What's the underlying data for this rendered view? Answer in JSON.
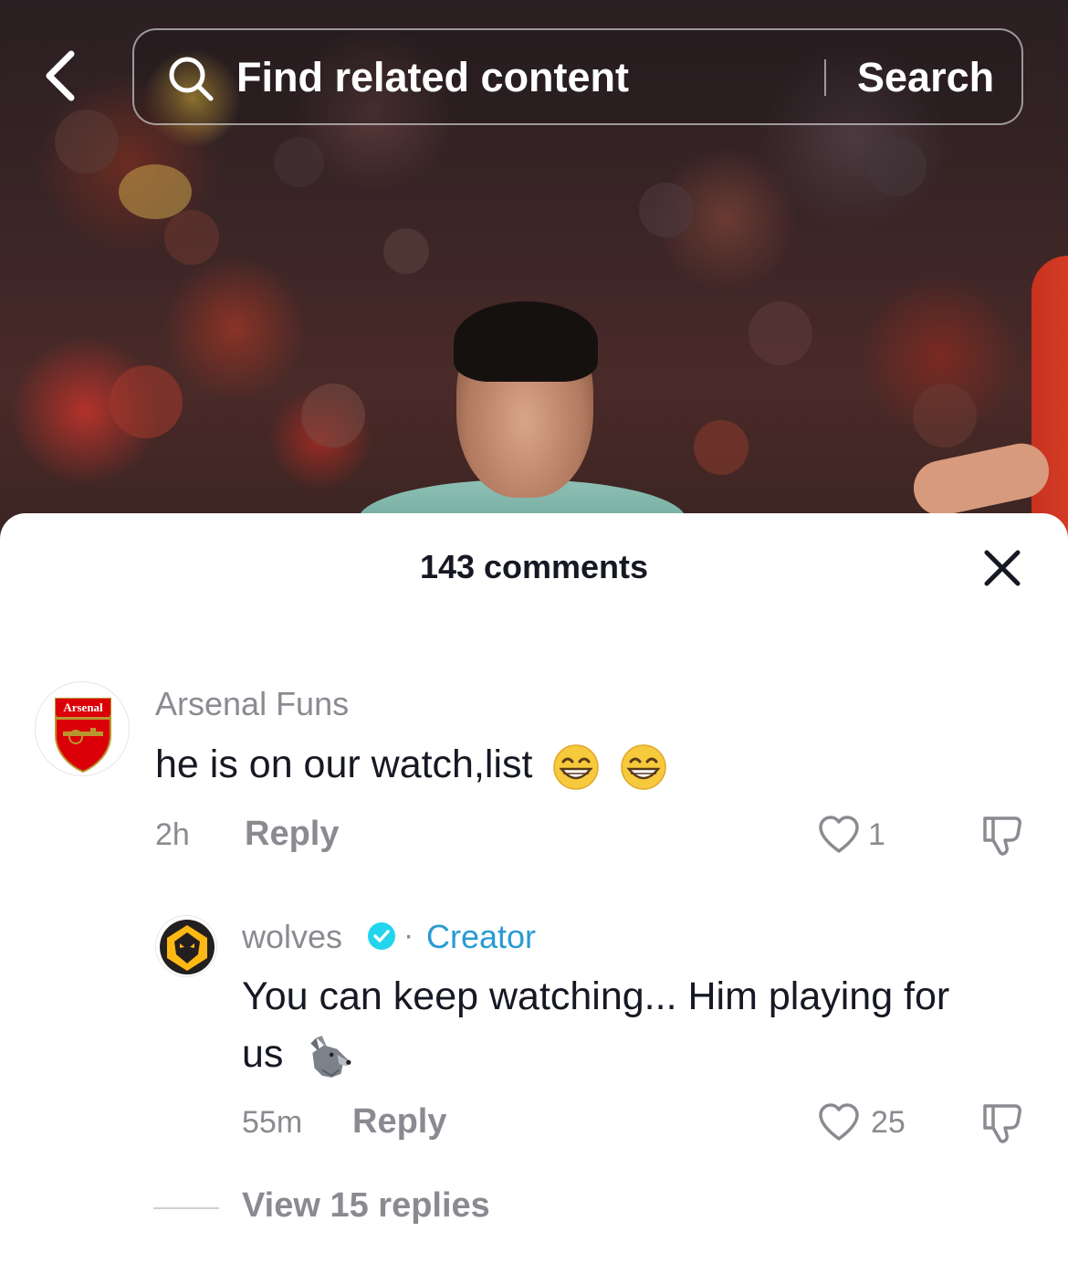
{
  "search": {
    "placeholder": "Find related content",
    "button_label": "Search"
  },
  "comments_panel": {
    "title": "143 comments"
  },
  "comments": [
    {
      "username": "Arsenal Funs",
      "avatar_text": "Arsenal",
      "text": "he is on our watch,list",
      "emojis": [
        "grinning-face",
        "grinning-face"
      ],
      "time": "2h",
      "reply_label": "Reply",
      "likes": "1"
    },
    {
      "username": "wolves",
      "verified": true,
      "separator": "·",
      "badge": "Creator",
      "text_line1": "You can keep watching... Him playing for",
      "text_line2": "us",
      "emoji": "wolf-face",
      "time": "55m",
      "reply_label": "Reply",
      "likes": "25"
    }
  ],
  "view_replies": "View 15 replies",
  "colors": {
    "creator_accent": "#2a9ad4",
    "muted_text": "#8a8b91",
    "primary_text": "#161823",
    "arsenal_red": "#db0007",
    "wolves_gold": "#fdb913"
  }
}
